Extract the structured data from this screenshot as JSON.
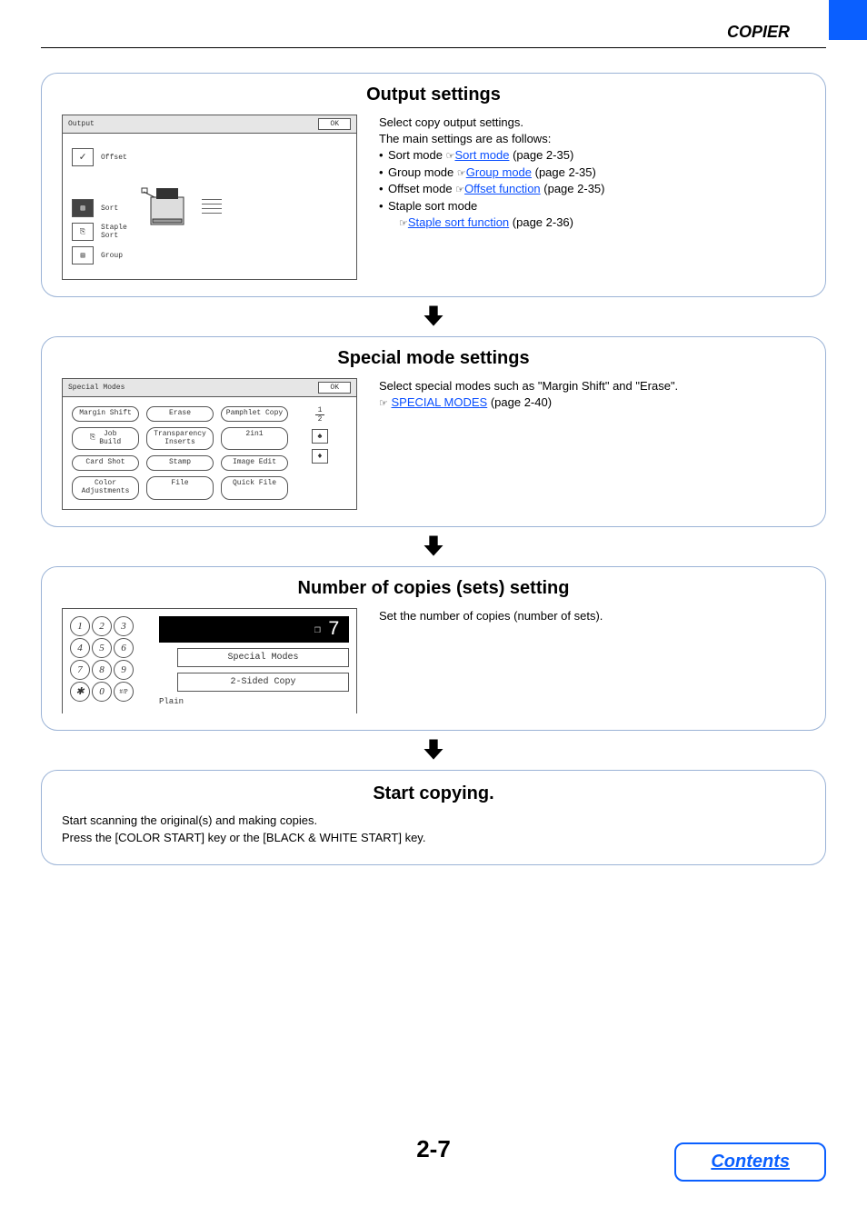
{
  "header": {
    "title": "COPIER"
  },
  "page_number": "2-7",
  "contents_button": "Contents",
  "panels": {
    "output": {
      "title": "Output settings",
      "screen": {
        "bar_title": "Output",
        "ok": "OK",
        "offset": "Offset",
        "sort": "Sort",
        "staple_sort": "Staple\nSort",
        "group": "Group"
      },
      "desc": {
        "intro1": "Select copy output settings.",
        "intro2": "The main settings are as follows:",
        "items": [
          {
            "label": "Sort mode ",
            "link": "Sort mode",
            "suffix": " (page 2-35)"
          },
          {
            "label": "Group mode ",
            "link": "Group mode",
            "suffix": " (page 2-35)"
          },
          {
            "label": "Offset mode ",
            "link": "Offset function",
            "suffix": " (page 2-35)"
          },
          {
            "label": "Staple sort mode",
            "link": "",
            "suffix": ""
          }
        ],
        "sublink": "Staple sort function",
        "subsuffix": " (page 2-36)"
      }
    },
    "special": {
      "title": "Special mode settings",
      "screen": {
        "bar_title": "Special Modes",
        "ok": "OK",
        "buttons": [
          "Margin Shift",
          "Erase",
          "Pamphlet Copy",
          "Job\nBuild",
          "Transparency\nInserts",
          "2in1",
          "Card Shot",
          "Stamp",
          "Image Edit",
          "Color\nAdjustments",
          "File",
          "Quick File"
        ],
        "page_top": "1",
        "page_bot": "2"
      },
      "desc": {
        "line1": "Select special modes such as \"Margin Shift\" and \"Erase\".",
        "link": "SPECIAL MODES",
        "suffix": " (page 2-40)"
      }
    },
    "copies": {
      "title": "Number of copies (sets) setting",
      "screen": {
        "keys": [
          "1",
          "2",
          "3",
          "4",
          "5",
          "6",
          "7",
          "8",
          "9",
          "✱",
          "0",
          "#/P"
        ],
        "display": "7",
        "btn1": "Special Modes",
        "btn2": "2-Sided Copy",
        "plain": "Plain"
      },
      "desc": {
        "line1": "Set the number of copies (number of sets)."
      }
    },
    "start": {
      "title": "Start copying.",
      "line1": "Start scanning the original(s) and making copies.",
      "line2": "Press the [COLOR START] key or the [BLACK & WHITE START] key."
    }
  }
}
